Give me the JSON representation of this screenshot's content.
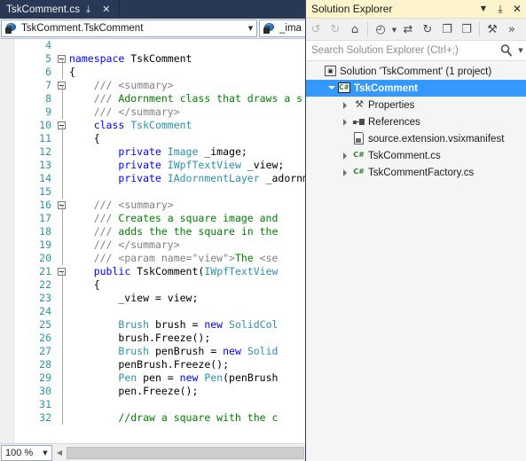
{
  "editor": {
    "tab": {
      "label": "TskComment.cs",
      "pin_icon": "pin-icon",
      "close_icon": "close-icon"
    },
    "navbar": {
      "type_scope": "TskComment.TskComment",
      "member_scope": "_ima",
      "type_icon": "class-private-icon",
      "member_icon": "field-private-icon",
      "caret_icon": "chevron-down-icon"
    },
    "zoom": {
      "value": "100 %",
      "caret_icon": "chevron-down-icon"
    },
    "hscroll": {
      "left_arrow_icon": "chevron-left-icon"
    },
    "first_line_number": 4,
    "lines": [
      {
        "n": 4,
        "fold": "none",
        "tokens": []
      },
      {
        "n": 5,
        "fold": "box-top",
        "tokens": [
          {
            "t": "namespace ",
            "c": "k"
          },
          {
            "t": "TskComment",
            "c": "pl"
          }
        ]
      },
      {
        "n": 6,
        "fold": "line",
        "tokens": [
          {
            "t": "{",
            "c": "pl"
          }
        ]
      },
      {
        "n": 7,
        "fold": "box-mid",
        "tokens": [
          {
            "t": "    /// ",
            "c": "cm"
          },
          {
            "t": "<summary>",
            "c": "xt"
          }
        ]
      },
      {
        "n": 8,
        "fold": "line",
        "tokens": [
          {
            "t": "    /// ",
            "c": "cm"
          },
          {
            "t": "Adornment class that draws a s",
            "c": "cd"
          }
        ]
      },
      {
        "n": 9,
        "fold": "line",
        "tokens": [
          {
            "t": "    /// ",
            "c": "cm"
          },
          {
            "t": "</summary>",
            "c": "xt"
          }
        ]
      },
      {
        "n": 10,
        "fold": "box-mid",
        "tokens": [
          {
            "t": "    ",
            "c": "pl"
          },
          {
            "t": "class ",
            "c": "k"
          },
          {
            "t": "TskComment",
            "c": "t"
          }
        ]
      },
      {
        "n": 11,
        "fold": "line",
        "tokens": [
          {
            "t": "    {",
            "c": "pl"
          }
        ]
      },
      {
        "n": 12,
        "fold": "line",
        "tokens": [
          {
            "t": "        ",
            "c": "pl"
          },
          {
            "t": "private ",
            "c": "k"
          },
          {
            "t": "Image",
            "c": "t"
          },
          {
            "t": " _image;",
            "c": "pl"
          }
        ]
      },
      {
        "n": 13,
        "fold": "line",
        "tokens": [
          {
            "t": "        ",
            "c": "pl"
          },
          {
            "t": "private ",
            "c": "k"
          },
          {
            "t": "IWpfTextView",
            "c": "t"
          },
          {
            "t": " _view;",
            "c": "pl"
          }
        ]
      },
      {
        "n": 14,
        "fold": "line",
        "tokens": [
          {
            "t": "        ",
            "c": "pl"
          },
          {
            "t": "private ",
            "c": "k"
          },
          {
            "t": "IAdornmentLayer",
            "c": "t"
          },
          {
            "t": " _adornm",
            "c": "pl"
          }
        ]
      },
      {
        "n": 15,
        "fold": "line",
        "tokens": []
      },
      {
        "n": 16,
        "fold": "box-mid",
        "tokens": [
          {
            "t": "    /// ",
            "c": "cm"
          },
          {
            "t": "<summary>",
            "c": "xt"
          }
        ]
      },
      {
        "n": 17,
        "fold": "line",
        "tokens": [
          {
            "t": "    /// ",
            "c": "cm"
          },
          {
            "t": "Creates a square image and",
            "c": "cd"
          }
        ]
      },
      {
        "n": 18,
        "fold": "line",
        "tokens": [
          {
            "t": "    /// ",
            "c": "cm"
          },
          {
            "t": "adds the the square in the",
            "c": "cd"
          }
        ]
      },
      {
        "n": 19,
        "fold": "line",
        "tokens": [
          {
            "t": "    /// ",
            "c": "cm"
          },
          {
            "t": "</summary>",
            "c": "xt"
          }
        ]
      },
      {
        "n": 20,
        "fold": "line",
        "tokens": [
          {
            "t": "    /// ",
            "c": "cm"
          },
          {
            "t": "<param name=\"view\">",
            "c": "xt"
          },
          {
            "t": "The ",
            "c": "cd"
          },
          {
            "t": "<se",
            "c": "xt"
          }
        ]
      },
      {
        "n": 21,
        "fold": "box-mid",
        "tokens": [
          {
            "t": "    ",
            "c": "pl"
          },
          {
            "t": "public ",
            "c": "k"
          },
          {
            "t": "TskComment(",
            "c": "pl"
          },
          {
            "t": "IWpfTextView",
            "c": "t"
          }
        ]
      },
      {
        "n": 22,
        "fold": "line",
        "tokens": [
          {
            "t": "    {",
            "c": "pl"
          }
        ]
      },
      {
        "n": 23,
        "fold": "line",
        "tokens": [
          {
            "t": "        _view = view;",
            "c": "pl"
          }
        ]
      },
      {
        "n": 24,
        "fold": "line",
        "tokens": []
      },
      {
        "n": 25,
        "fold": "line",
        "tokens": [
          {
            "t": "        ",
            "c": "pl"
          },
          {
            "t": "Brush",
            "c": "t"
          },
          {
            "t": " brush = ",
            "c": "pl"
          },
          {
            "t": "new ",
            "c": "k"
          },
          {
            "t": "SolidCol",
            "c": "t"
          }
        ]
      },
      {
        "n": 26,
        "fold": "line",
        "tokens": [
          {
            "t": "        brush.Freeze();",
            "c": "pl"
          }
        ]
      },
      {
        "n": 27,
        "fold": "line",
        "tokens": [
          {
            "t": "        ",
            "c": "pl"
          },
          {
            "t": "Brush",
            "c": "t"
          },
          {
            "t": " penBrush = ",
            "c": "pl"
          },
          {
            "t": "new ",
            "c": "k"
          },
          {
            "t": "Solid",
            "c": "t"
          }
        ]
      },
      {
        "n": 28,
        "fold": "line",
        "tokens": [
          {
            "t": "        penBrush.Freeze();",
            "c": "pl"
          }
        ]
      },
      {
        "n": 29,
        "fold": "line",
        "tokens": [
          {
            "t": "        ",
            "c": "pl"
          },
          {
            "t": "Pen",
            "c": "t"
          },
          {
            "t": " pen = ",
            "c": "pl"
          },
          {
            "t": "new ",
            "c": "k"
          },
          {
            "t": "Pen",
            "c": "t"
          },
          {
            "t": "(penBrush",
            "c": "pl"
          }
        ]
      },
      {
        "n": 30,
        "fold": "line",
        "tokens": [
          {
            "t": "        pen.Freeze();",
            "c": "pl"
          }
        ]
      },
      {
        "n": 31,
        "fold": "line",
        "tokens": []
      },
      {
        "n": 32,
        "fold": "line",
        "tokens": [
          {
            "t": "        //draw a square with the c",
            "c": "cd"
          }
        ]
      }
    ]
  },
  "solution_explorer": {
    "title": "Solution Explorer",
    "title_buttons": [
      {
        "name": "window-menu-button",
        "icon": "chevron-down-icon",
        "glyph": "▼",
        "cls": "caret"
      },
      {
        "name": "auto-hide-button",
        "icon": "pin-icon",
        "glyph": "⤓",
        "cls": "pin"
      },
      {
        "name": "close-window-button",
        "icon": "close-icon",
        "glyph": "✕",
        "cls": "close"
      }
    ],
    "toolbar": [
      {
        "name": "navigate-back-button",
        "icon": "back-arrow-icon",
        "glyph": "↺",
        "dim": true,
        "caret": false
      },
      {
        "name": "navigate-forward-button",
        "icon": "forward-arrow-icon",
        "glyph": "↻",
        "dim": true,
        "caret": false
      },
      {
        "name": "home-button",
        "icon": "home-icon",
        "glyph": "⌂",
        "dim": false,
        "caret": false
      },
      {
        "name": "separator-1",
        "icon": "separator",
        "glyph": "",
        "dim": false,
        "caret": false
      },
      {
        "name": "pending-changes-button",
        "icon": "clock-filter-icon",
        "glyph": "◴",
        "dim": false,
        "caret": true
      },
      {
        "name": "sync-with-active-doc-button",
        "icon": "sync-arrows-icon",
        "glyph": "⇄",
        "dim": false,
        "caret": false
      },
      {
        "name": "refresh-button",
        "icon": "refresh-icon",
        "glyph": "↻",
        "dim": false,
        "caret": false
      },
      {
        "name": "collapse-all-button",
        "icon": "collapse-all-icon",
        "glyph": "❐",
        "dim": false,
        "caret": false
      },
      {
        "name": "show-all-files-button",
        "icon": "show-all-files-icon",
        "glyph": "❐",
        "dim": false,
        "caret": false
      },
      {
        "name": "separator-2",
        "icon": "separator",
        "glyph": "",
        "dim": false,
        "caret": false
      },
      {
        "name": "properties-button",
        "icon": "wrench-icon",
        "glyph": "⚒",
        "dim": false,
        "caret": false
      },
      {
        "name": "overflow-button",
        "icon": "chevron-double-right-icon",
        "glyph": "»",
        "dim": false,
        "caret": false
      }
    ],
    "search": {
      "placeholder": "Search Solution Explorer (Ctrl+;)",
      "value": "",
      "icon": "search-icon",
      "caret_icon": "chevron-down-icon"
    },
    "tree": [
      {
        "label": "Solution 'TskComment' (1 project)",
        "icon": "solution-icon",
        "indent": 0,
        "expander": "none",
        "selected": false
      },
      {
        "label": "TskComment",
        "icon": "csharp-project-icon",
        "indent": 1,
        "expander": "expanded",
        "selected": true
      },
      {
        "label": "Properties",
        "icon": "properties-icon",
        "indent": 2,
        "expander": "collapsed",
        "selected": false
      },
      {
        "label": "References",
        "icon": "references-icon",
        "indent": 2,
        "expander": "collapsed",
        "selected": false
      },
      {
        "label": "source.extension.vsixmanifest",
        "icon": "manifest-icon",
        "indent": 2,
        "expander": "none",
        "selected": false
      },
      {
        "label": "TskComment.cs",
        "icon": "csharp-file-icon",
        "indent": 2,
        "expander": "collapsed",
        "selected": false
      },
      {
        "label": "TskCommentFactory.cs",
        "icon": "csharp-file-icon",
        "indent": 2,
        "expander": "collapsed",
        "selected": false
      }
    ]
  },
  "colors": {
    "tab_bg": "#293955",
    "title_bg": "#fdf4ce",
    "selection_blue": "#3399ff",
    "line_number": "#2b91af",
    "keyword": "#0000ff",
    "type": "#2b91af",
    "comment": "#008000",
    "xml_tag": "#808080"
  }
}
